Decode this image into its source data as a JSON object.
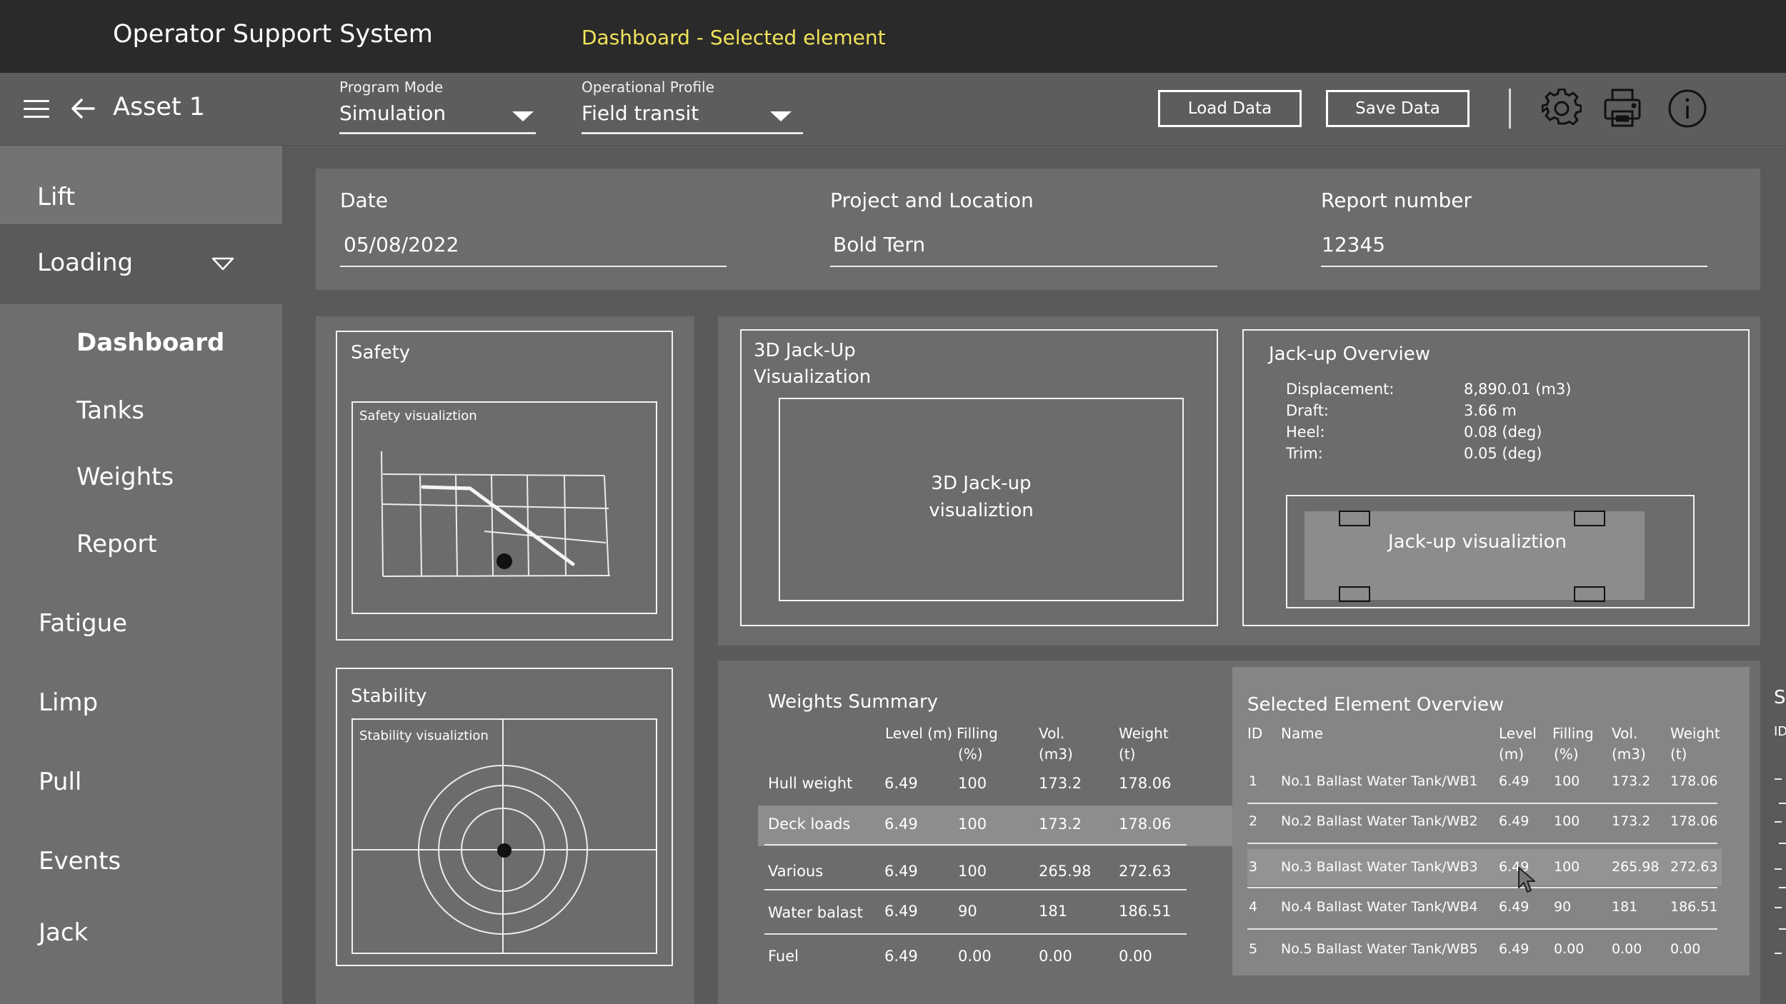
{
  "header": {
    "app_title": "Operator Support System",
    "screen_title": "Dashboard - Selected element",
    "accent_color": "#f0e35a"
  },
  "toolbar": {
    "asset": "Asset 1",
    "program_mode": {
      "label": "Program Mode",
      "value": "Simulation"
    },
    "operational_profile": {
      "label": "Operational Profile",
      "value": "Field transit"
    },
    "load_label": "Load Data",
    "save_label": "Save Data",
    "icons": [
      "menu-icon",
      "back-arrow-icon",
      "gear-icon",
      "printer-icon",
      "info-icon"
    ]
  },
  "sidebar": {
    "lift": "Lift",
    "loading": "Loading",
    "sub_items": [
      "Dashboard",
      "Tanks",
      "Weights",
      "Report"
    ],
    "active_sub": "Dashboard",
    "items": [
      "Fatigue",
      "Limp",
      "Pull",
      "Events",
      "Jack"
    ]
  },
  "info": {
    "date": {
      "label": "Date",
      "value": "05/08/2022"
    },
    "project": {
      "label": "Project and Location",
      "value": "Bold Tern"
    },
    "report": {
      "label": "Report number",
      "value": "12345"
    }
  },
  "safety": {
    "title": "Safety",
    "viz": "Safety visualiztion"
  },
  "stability": {
    "title": "Stability",
    "viz": "Stability visualiztion"
  },
  "jackup3d": {
    "title_line1": "3D  Jack-Up",
    "title_line2": "Visualization",
    "viz_line1": "3D Jack-up",
    "viz_line2": "visualiztion"
  },
  "overview": {
    "title": "Jack-up Overview",
    "rows": [
      {
        "label": "Displacement:",
        "value": "8,890.01 (m3)"
      },
      {
        "label": "Draft:",
        "value": "3.66 m"
      },
      {
        "label": "Heel:",
        "value": "0.08 (deg)"
      },
      {
        "label": "Trim:",
        "value": "0.05 (deg)"
      }
    ],
    "viz": "Jack-up visualiztion"
  },
  "weights": {
    "title": "Weights Summary",
    "headers": [
      {
        "l1": "Level (m)",
        "l2": ""
      },
      {
        "l1": "Filling",
        "l2": "(%)"
      },
      {
        "l1": "Vol.",
        "l2": "(m3)"
      },
      {
        "l1": "Weight",
        "l2": "(t)"
      }
    ],
    "rows": [
      {
        "name": "Hull weight",
        "level": "6.49",
        "filling": "100",
        "vol": "173.2",
        "weight": "178.06"
      },
      {
        "name": "Deck loads",
        "level": "6.49",
        "filling": "100",
        "vol": "173.2",
        "weight": "178.06"
      },
      {
        "name": "Various",
        "level": "6.49",
        "filling": "100",
        "vol": "265.98",
        "weight": "272.63"
      },
      {
        "name": "Water balast",
        "level": "6.49",
        "filling": "90",
        "vol": "181",
        "weight": "186.51"
      },
      {
        "name": "Fuel",
        "level": "6.49",
        "filling": "0.00",
        "vol": "0.00",
        "weight": "0.00"
      }
    ]
  },
  "selected": {
    "title": "Selected Element Overview",
    "headers": [
      {
        "l1": "ID",
        "l2": ""
      },
      {
        "l1": "Name",
        "l2": ""
      },
      {
        "l1": "Level",
        "l2": "(m)"
      },
      {
        "l1": "Filling",
        "l2": "(%)"
      },
      {
        "l1": "Vol.",
        "l2": "(m3)"
      },
      {
        "l1": "Weight",
        "l2": "(t)"
      }
    ],
    "rows": [
      {
        "id": "1",
        "name": "No.1 Ballast Water Tank/WB1",
        "level": "6.49",
        "filling": "100",
        "vol": "173.2",
        "weight": "178.06"
      },
      {
        "id": "2",
        "name": "No.2 Ballast Water Tank/WB2",
        "level": "6.49",
        "filling": "100",
        "vol": "173.2",
        "weight": "178.06"
      },
      {
        "id": "3",
        "name": "No.3 Ballast Water Tank/WB3",
        "level": "6.49",
        "filling": "100",
        "vol": "265.98",
        "weight": "272.63"
      },
      {
        "id": "4",
        "name": "No.4 Ballast Water Tank/WB4",
        "level": "6.49",
        "filling": "90",
        "vol": "181",
        "weight": "186.51"
      },
      {
        "id": "5",
        "name": "No.5 Ballast Water Tank/WB5",
        "level": "6.49",
        "filling": "0.00",
        "vol": "0.00",
        "weight": "0.00"
      }
    ]
  },
  "partial_panel": {
    "title_fragment": "Se",
    "header_fragment": "ID"
  }
}
